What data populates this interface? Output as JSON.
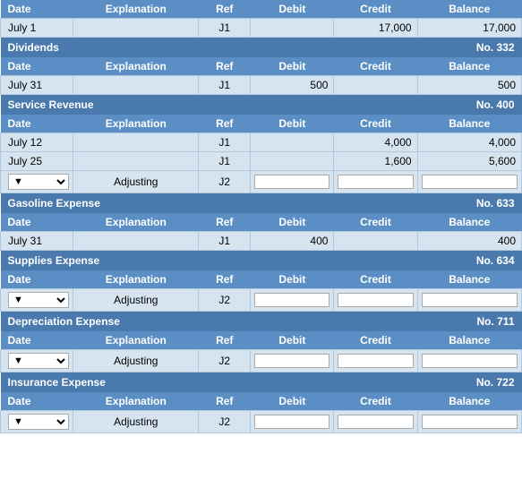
{
  "sections": [
    {
      "id": "cash",
      "title": null,
      "number": null,
      "headers": [
        "Date",
        "Explanation",
        "Ref",
        "Debit",
        "Credit",
        "Balance"
      ],
      "rows": [
        {
          "type": "data",
          "date": "July 1",
          "explanation": "",
          "ref": "J1",
          "debit": "",
          "credit": "17,000",
          "balance": "17,000"
        }
      ],
      "input_rows": []
    },
    {
      "id": "dividends",
      "title": "Dividends",
      "number": "No. 332",
      "headers": [
        "Date",
        "Explanation",
        "Ref",
        "Debit",
        "Credit",
        "Balance"
      ],
      "rows": [
        {
          "type": "data",
          "date": "July 31",
          "explanation": "",
          "ref": "J1",
          "debit": "500",
          "credit": "",
          "balance": "500"
        }
      ],
      "input_rows": []
    },
    {
      "id": "service-revenue",
      "title": "Service Revenue",
      "number": "No. 400",
      "headers": [
        "Date",
        "Explanation",
        "Ref",
        "Debit",
        "Credit",
        "Balance"
      ],
      "rows": [
        {
          "type": "data",
          "date": "July 12",
          "explanation": "",
          "ref": "J1",
          "debit": "",
          "credit": "4,000",
          "balance": "4,000"
        },
        {
          "type": "data",
          "date": "July 25",
          "explanation": "",
          "ref": "J1",
          "debit": "",
          "credit": "1,600",
          "balance": "5,600"
        }
      ],
      "input_rows": [
        {
          "explanation": "Adjusting",
          "ref": "J2"
        }
      ]
    },
    {
      "id": "gasoline-expense",
      "title": "Gasoline Expense",
      "number": "No. 633",
      "headers": [
        "Date",
        "Explanation",
        "Ref",
        "Debit",
        "Credit",
        "Balance"
      ],
      "rows": [
        {
          "type": "data",
          "date": "July 31",
          "explanation": "",
          "ref": "J1",
          "debit": "400",
          "credit": "",
          "balance": "400"
        }
      ],
      "input_rows": []
    },
    {
      "id": "supplies-expense",
      "title": "Supplies Expense",
      "number": "No. 634",
      "headers": [
        "Date",
        "Explanation",
        "Ref",
        "Debit",
        "Credit",
        "Balance"
      ],
      "rows": [],
      "input_rows": [
        {
          "explanation": "Adjusting",
          "ref": "J2"
        }
      ]
    },
    {
      "id": "depreciation-expense",
      "title": "Depreciation Expense",
      "number": "No. 711",
      "headers": [
        "Date",
        "Explanation",
        "Ref",
        "Debit",
        "Credit",
        "Balance"
      ],
      "rows": [],
      "input_rows": [
        {
          "explanation": "Adjusting",
          "ref": "J2"
        }
      ]
    },
    {
      "id": "insurance-expense",
      "title": "Insurance Expense",
      "number": "No. 722",
      "headers": [
        "Date",
        "Explanation",
        "Ref",
        "Debit",
        "Credit",
        "Balance"
      ],
      "rows": [],
      "input_rows": [
        {
          "explanation": "Adjusting",
          "ref": "J2"
        }
      ]
    }
  ],
  "labels": {
    "date": "Date",
    "explanation": "Explanation",
    "ref": "Ref",
    "debit": "Debit",
    "credit": "Credit",
    "balance": "Balance"
  }
}
